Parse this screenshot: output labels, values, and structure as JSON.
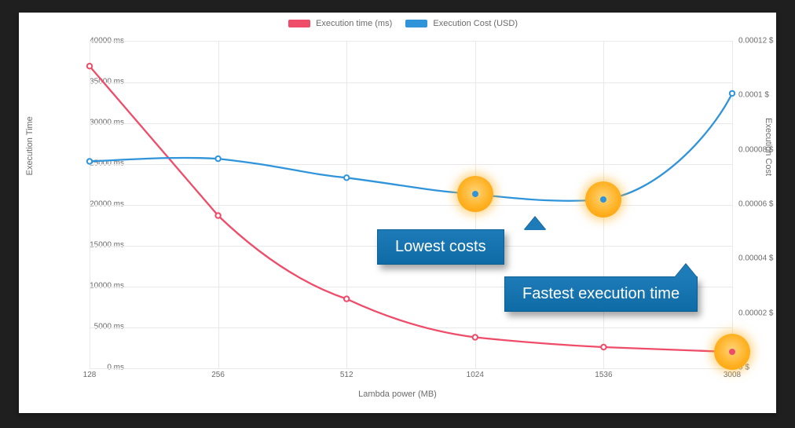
{
  "legend": {
    "time": "Execution time (ms)",
    "cost": "Execution Cost (USD)"
  },
  "axes": {
    "xlabel": "Lambda power (MB)",
    "ylabel_left": "Execution Time",
    "ylabel_right": "Execution Cost",
    "xticks": [
      "128",
      "256",
      "512",
      "1024",
      "1536",
      "3008"
    ],
    "yticks_left": [
      "0 ms",
      "5000 ms",
      "10000 ms",
      "15000 ms",
      "20000 ms",
      "25000 ms",
      "30000 ms",
      "35000 ms",
      "40000 ms"
    ],
    "yticks_right": [
      "0 $",
      "0.00002 $",
      "0.00004 $",
      "0.00006 $",
      "0.00008 $",
      "0.0001 $",
      "0.00012 $"
    ]
  },
  "callouts": {
    "costs": "Lowest costs",
    "fastest": "Fastest execution time"
  },
  "chart_data": {
    "type": "line",
    "xlabel": "Lambda power (MB)",
    "ylabel_left": "Execution Time",
    "ylabel_right": "Execution Cost",
    "categories": [
      128,
      256,
      512,
      1024,
      1536,
      3008
    ],
    "ylim_left": [
      0,
      40000
    ],
    "ylim_right": [
      0,
      0.00012
    ],
    "series": [
      {
        "name": "Execution time (ms)",
        "axis": "left",
        "color": "#ef4c69",
        "values": [
          37000,
          18700,
          8500,
          3800,
          2600,
          2000
        ]
      },
      {
        "name": "Execution Cost (USD)",
        "axis": "right",
        "color": "#2f94d9",
        "values": [
          7.6e-05,
          7.7e-05,
          7e-05,
          6.4e-05,
          6.2e-05,
          0.000101
        ]
      }
    ],
    "annotations": [
      {
        "text": "Lowest costs",
        "targets": [
          1024,
          1536
        ],
        "series": "Execution Cost (USD)"
      },
      {
        "text": "Fastest execution time",
        "targets": [
          3008
        ],
        "series": "Execution time (ms)"
      }
    ]
  }
}
